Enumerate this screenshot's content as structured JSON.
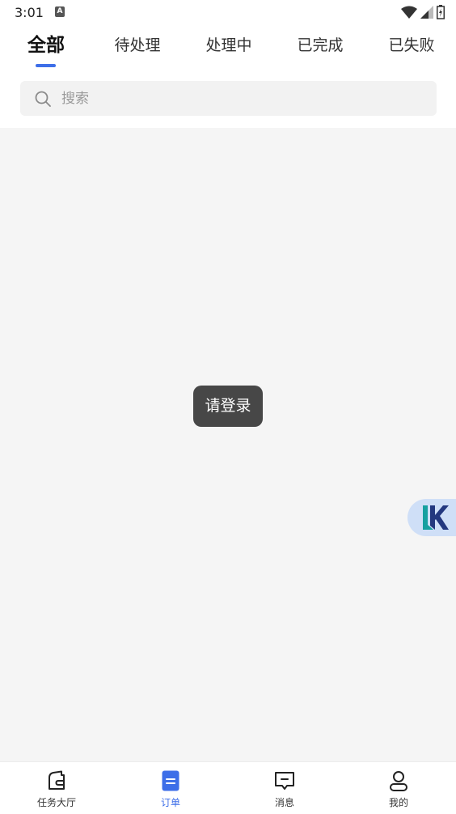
{
  "status_bar": {
    "time": "3:01",
    "notification_glyph": "A"
  },
  "tabs": [
    {
      "label": "全部",
      "active": true
    },
    {
      "label": "待处理",
      "active": false
    },
    {
      "label": "处理中",
      "active": false
    },
    {
      "label": "已完成",
      "active": false
    },
    {
      "label": "已失败",
      "active": false
    }
  ],
  "search": {
    "placeholder": "搜索",
    "value": ""
  },
  "toast": {
    "text": "请登录"
  },
  "bottom_nav": [
    {
      "label": "任务大厅",
      "icon": "wallet-icon",
      "active": false
    },
    {
      "label": "订单",
      "icon": "document-icon",
      "active": true
    },
    {
      "label": "消息",
      "icon": "message-icon",
      "active": false
    },
    {
      "label": "我的",
      "icon": "profile-icon",
      "active": false
    }
  ],
  "colors": {
    "accent": "#3d6ee8",
    "background": "#f5f5f5",
    "toast": "#474747",
    "logo_bubble": "#cfdff7"
  }
}
